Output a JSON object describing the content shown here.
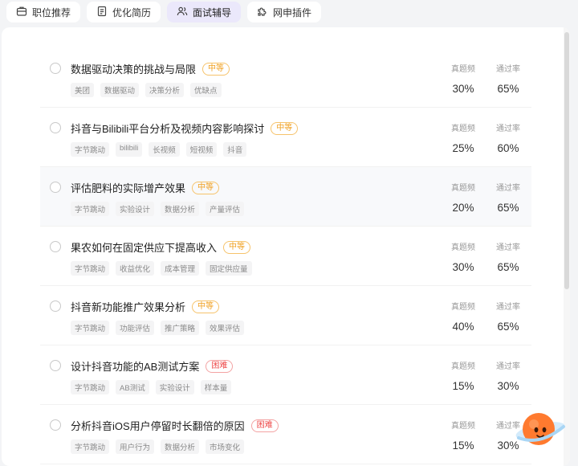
{
  "tabs": [
    {
      "label": "职位推荐",
      "icon": "briefcase-icon",
      "active": false
    },
    {
      "label": "优化简历",
      "icon": "document-icon",
      "active": false
    },
    {
      "label": "面试辅导",
      "icon": "people-icon",
      "active": true
    },
    {
      "label": "网申插件",
      "icon": "puzzle-icon",
      "active": false
    }
  ],
  "stat_labels": {
    "freq": "真题频",
    "pass": "通过率"
  },
  "colors": {
    "medium": "#f0a020",
    "hard": "#ee4a4a",
    "active_tab": "#ebe8fb"
  },
  "questions": [
    {
      "title": "数据驱动决策的挑战与局限",
      "difficulty": "中等",
      "level": "medium",
      "tags": [
        "美团",
        "数据驱动",
        "决策分析",
        "优缺点"
      ],
      "freq": "30%",
      "pass": "65%"
    },
    {
      "title": "抖音与Bilibili平台分析及视频内容影响探讨",
      "difficulty": "中等",
      "level": "medium",
      "tags": [
        "字节跳动",
        "bilibili",
        "长视频",
        "短视频",
        "抖音"
      ],
      "freq": "25%",
      "pass": "60%"
    },
    {
      "title": "评估肥料的实际增产效果",
      "difficulty": "中等",
      "level": "medium",
      "tags": [
        "字节跳动",
        "实验设计",
        "数据分析",
        "产量评估"
      ],
      "freq": "20%",
      "pass": "65%"
    },
    {
      "title": "果农如何在固定供应下提高收入",
      "difficulty": "中等",
      "level": "medium",
      "tags": [
        "字节跳动",
        "收益优化",
        "成本管理",
        "固定供应量"
      ],
      "freq": "30%",
      "pass": "65%"
    },
    {
      "title": "抖音新功能推广效果分析",
      "difficulty": "中等",
      "level": "medium",
      "tags": [
        "字节跳动",
        "功能评估",
        "推广策略",
        "效果评估"
      ],
      "freq": "40%",
      "pass": "65%"
    },
    {
      "title": "设计抖音功能的AB测试方案",
      "difficulty": "困难",
      "level": "hard",
      "tags": [
        "字节跳动",
        "AB测试",
        "实验设计",
        "样本量"
      ],
      "freq": "15%",
      "pass": "30%"
    },
    {
      "title": "分析抖音iOS用户停留时长翻倍的原因",
      "difficulty": "困难",
      "level": "hard",
      "tags": [
        "字节跳动",
        "用户行为",
        "数据分析",
        "市场变化"
      ],
      "freq": "15%",
      "pass": "30%"
    }
  ]
}
